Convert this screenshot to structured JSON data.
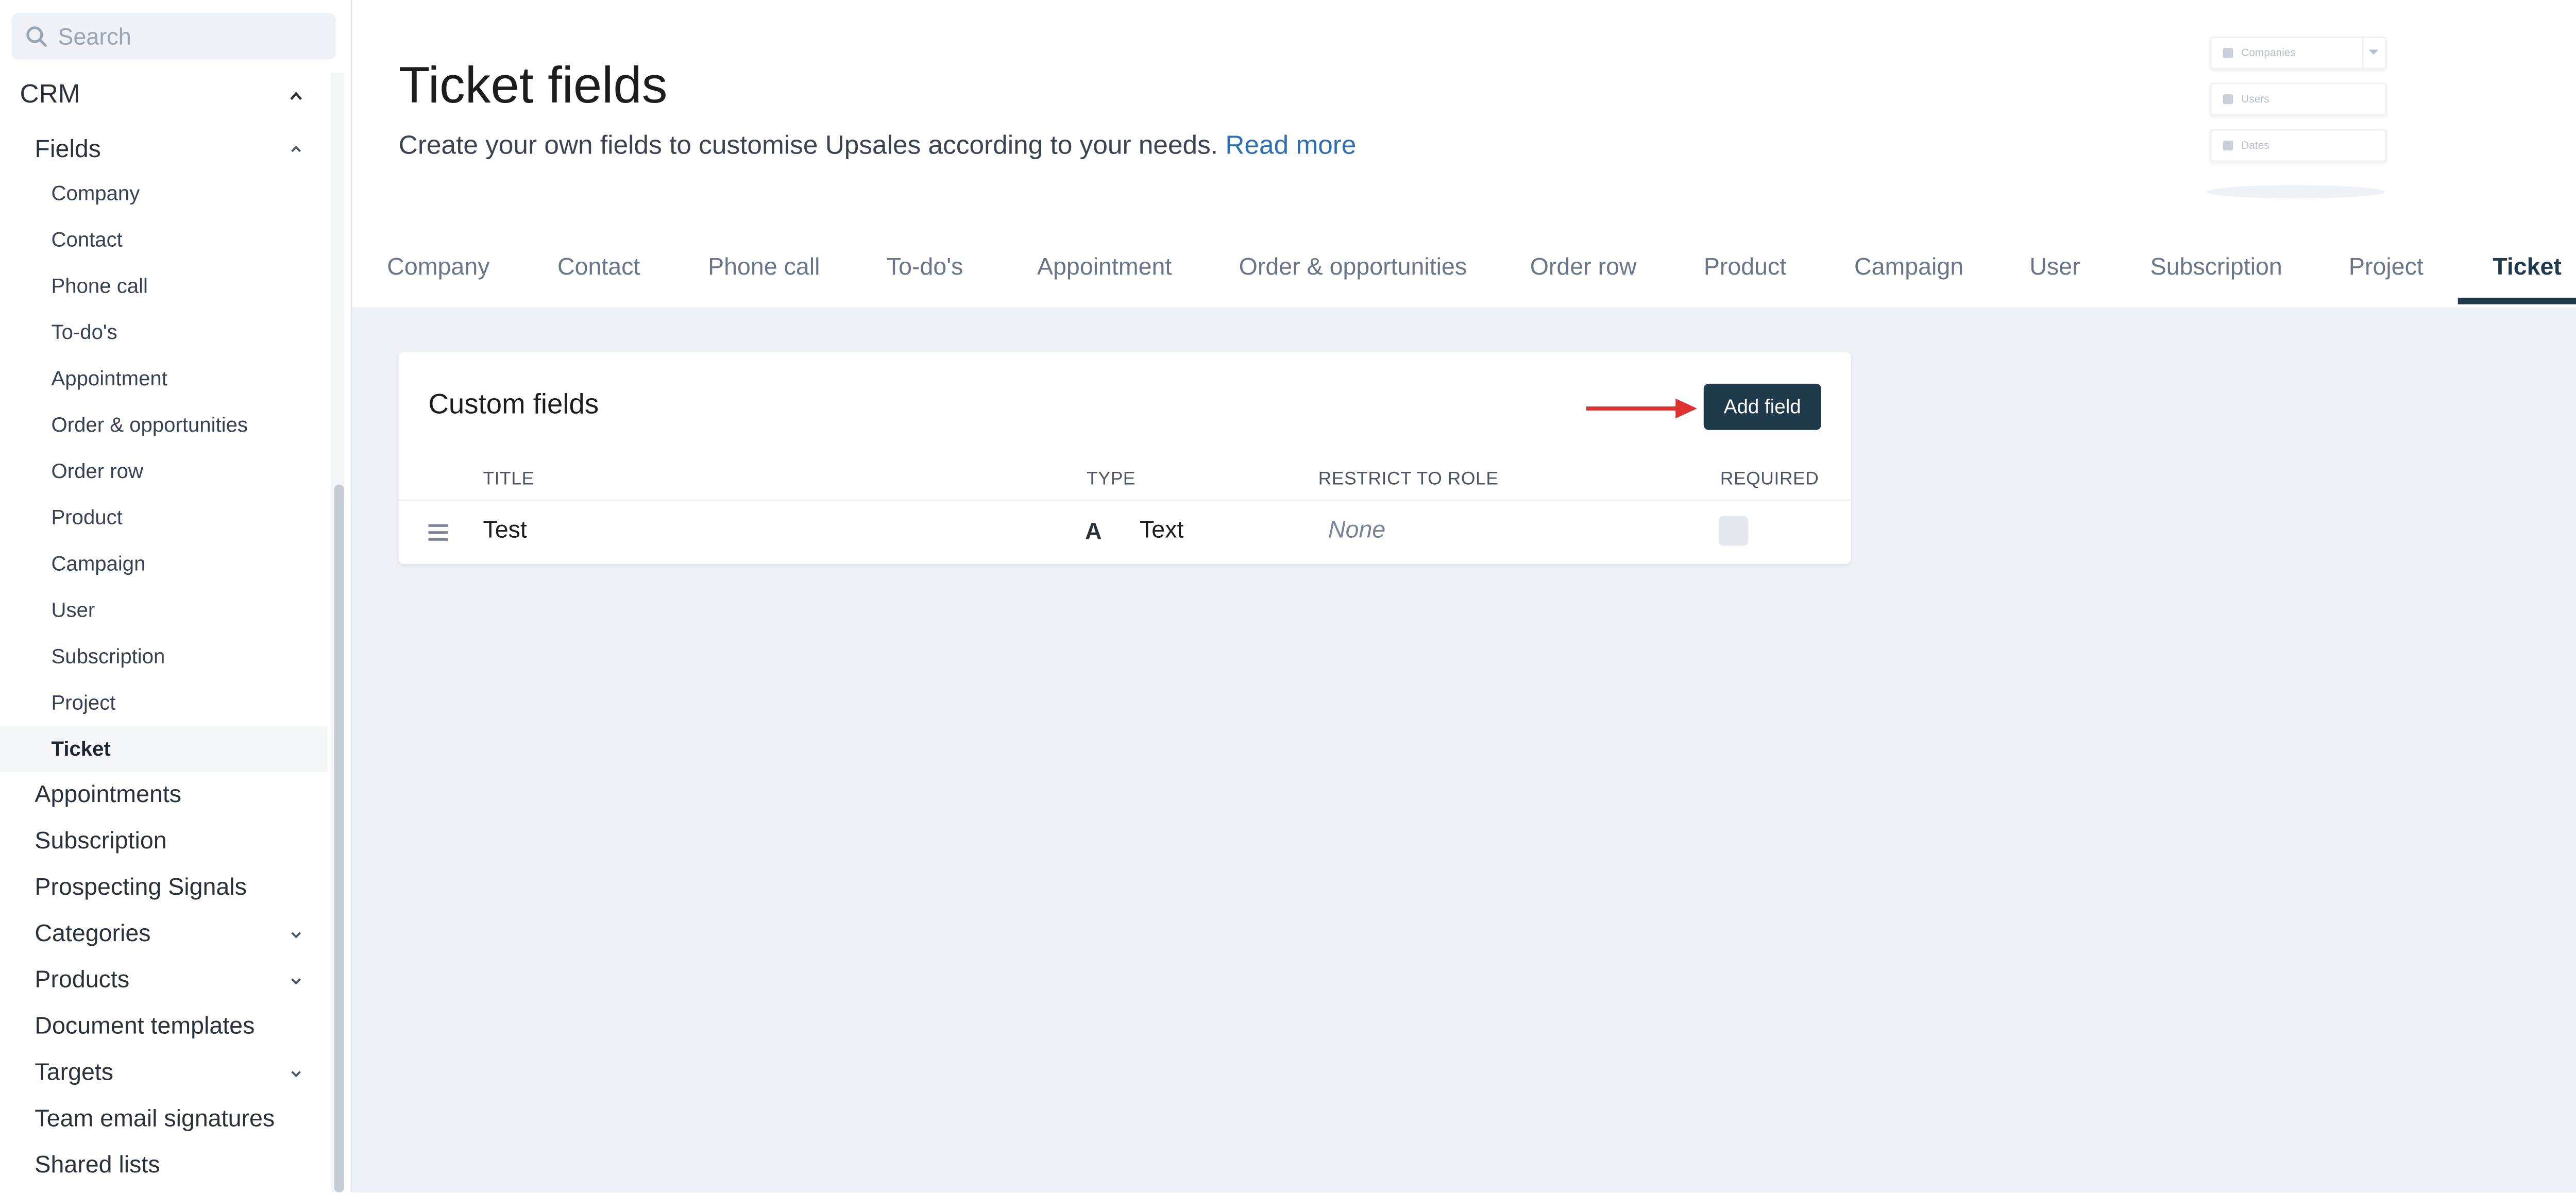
{
  "sidebar": {
    "search_placeholder": "Search",
    "crm_label": "CRM",
    "fields_label": "Fields",
    "field_items": [
      "Company",
      "Contact",
      "Phone call",
      "To-do's",
      "Appointment",
      "Order & opportunities",
      "Order row",
      "Product",
      "Campaign",
      "User",
      "Subscription",
      "Project",
      "Ticket"
    ],
    "active_field_item": "Ticket",
    "top_items": [
      "Appointments",
      "Subscription",
      "Prospecting Signals",
      "Categories",
      "Products",
      "Document templates",
      "Targets",
      "Team email signatures",
      "Shared lists"
    ]
  },
  "header": {
    "title": "Ticket fields",
    "description": "Create your own fields to customise Upsales according to your needs.",
    "read_more": "Read more",
    "illustration_labels": [
      "Companies",
      "Users",
      "Dates"
    ]
  },
  "tabs": [
    "Company",
    "Contact",
    "Phone call",
    "To-do's",
    "Appointment",
    "Order & opportunities",
    "Order row",
    "Product",
    "Campaign",
    "User",
    "Subscription",
    "Project",
    "Ticket"
  ],
  "active_tab": "Ticket",
  "custom_fields": {
    "title": "Custom fields",
    "add_button": "Add field",
    "columns": {
      "title": "TITLE",
      "type": "TYPE",
      "role": "RESTRICT TO ROLE",
      "required": "REQUIRED"
    },
    "rows": [
      {
        "title": "Test",
        "type_icon": "A",
        "type": "Text",
        "role": "None",
        "required": false
      }
    ]
  },
  "colors": {
    "primary": "#1f3a4a",
    "link": "#2f6fb3",
    "arrow": "#e03131",
    "background": "#edf0f4"
  }
}
